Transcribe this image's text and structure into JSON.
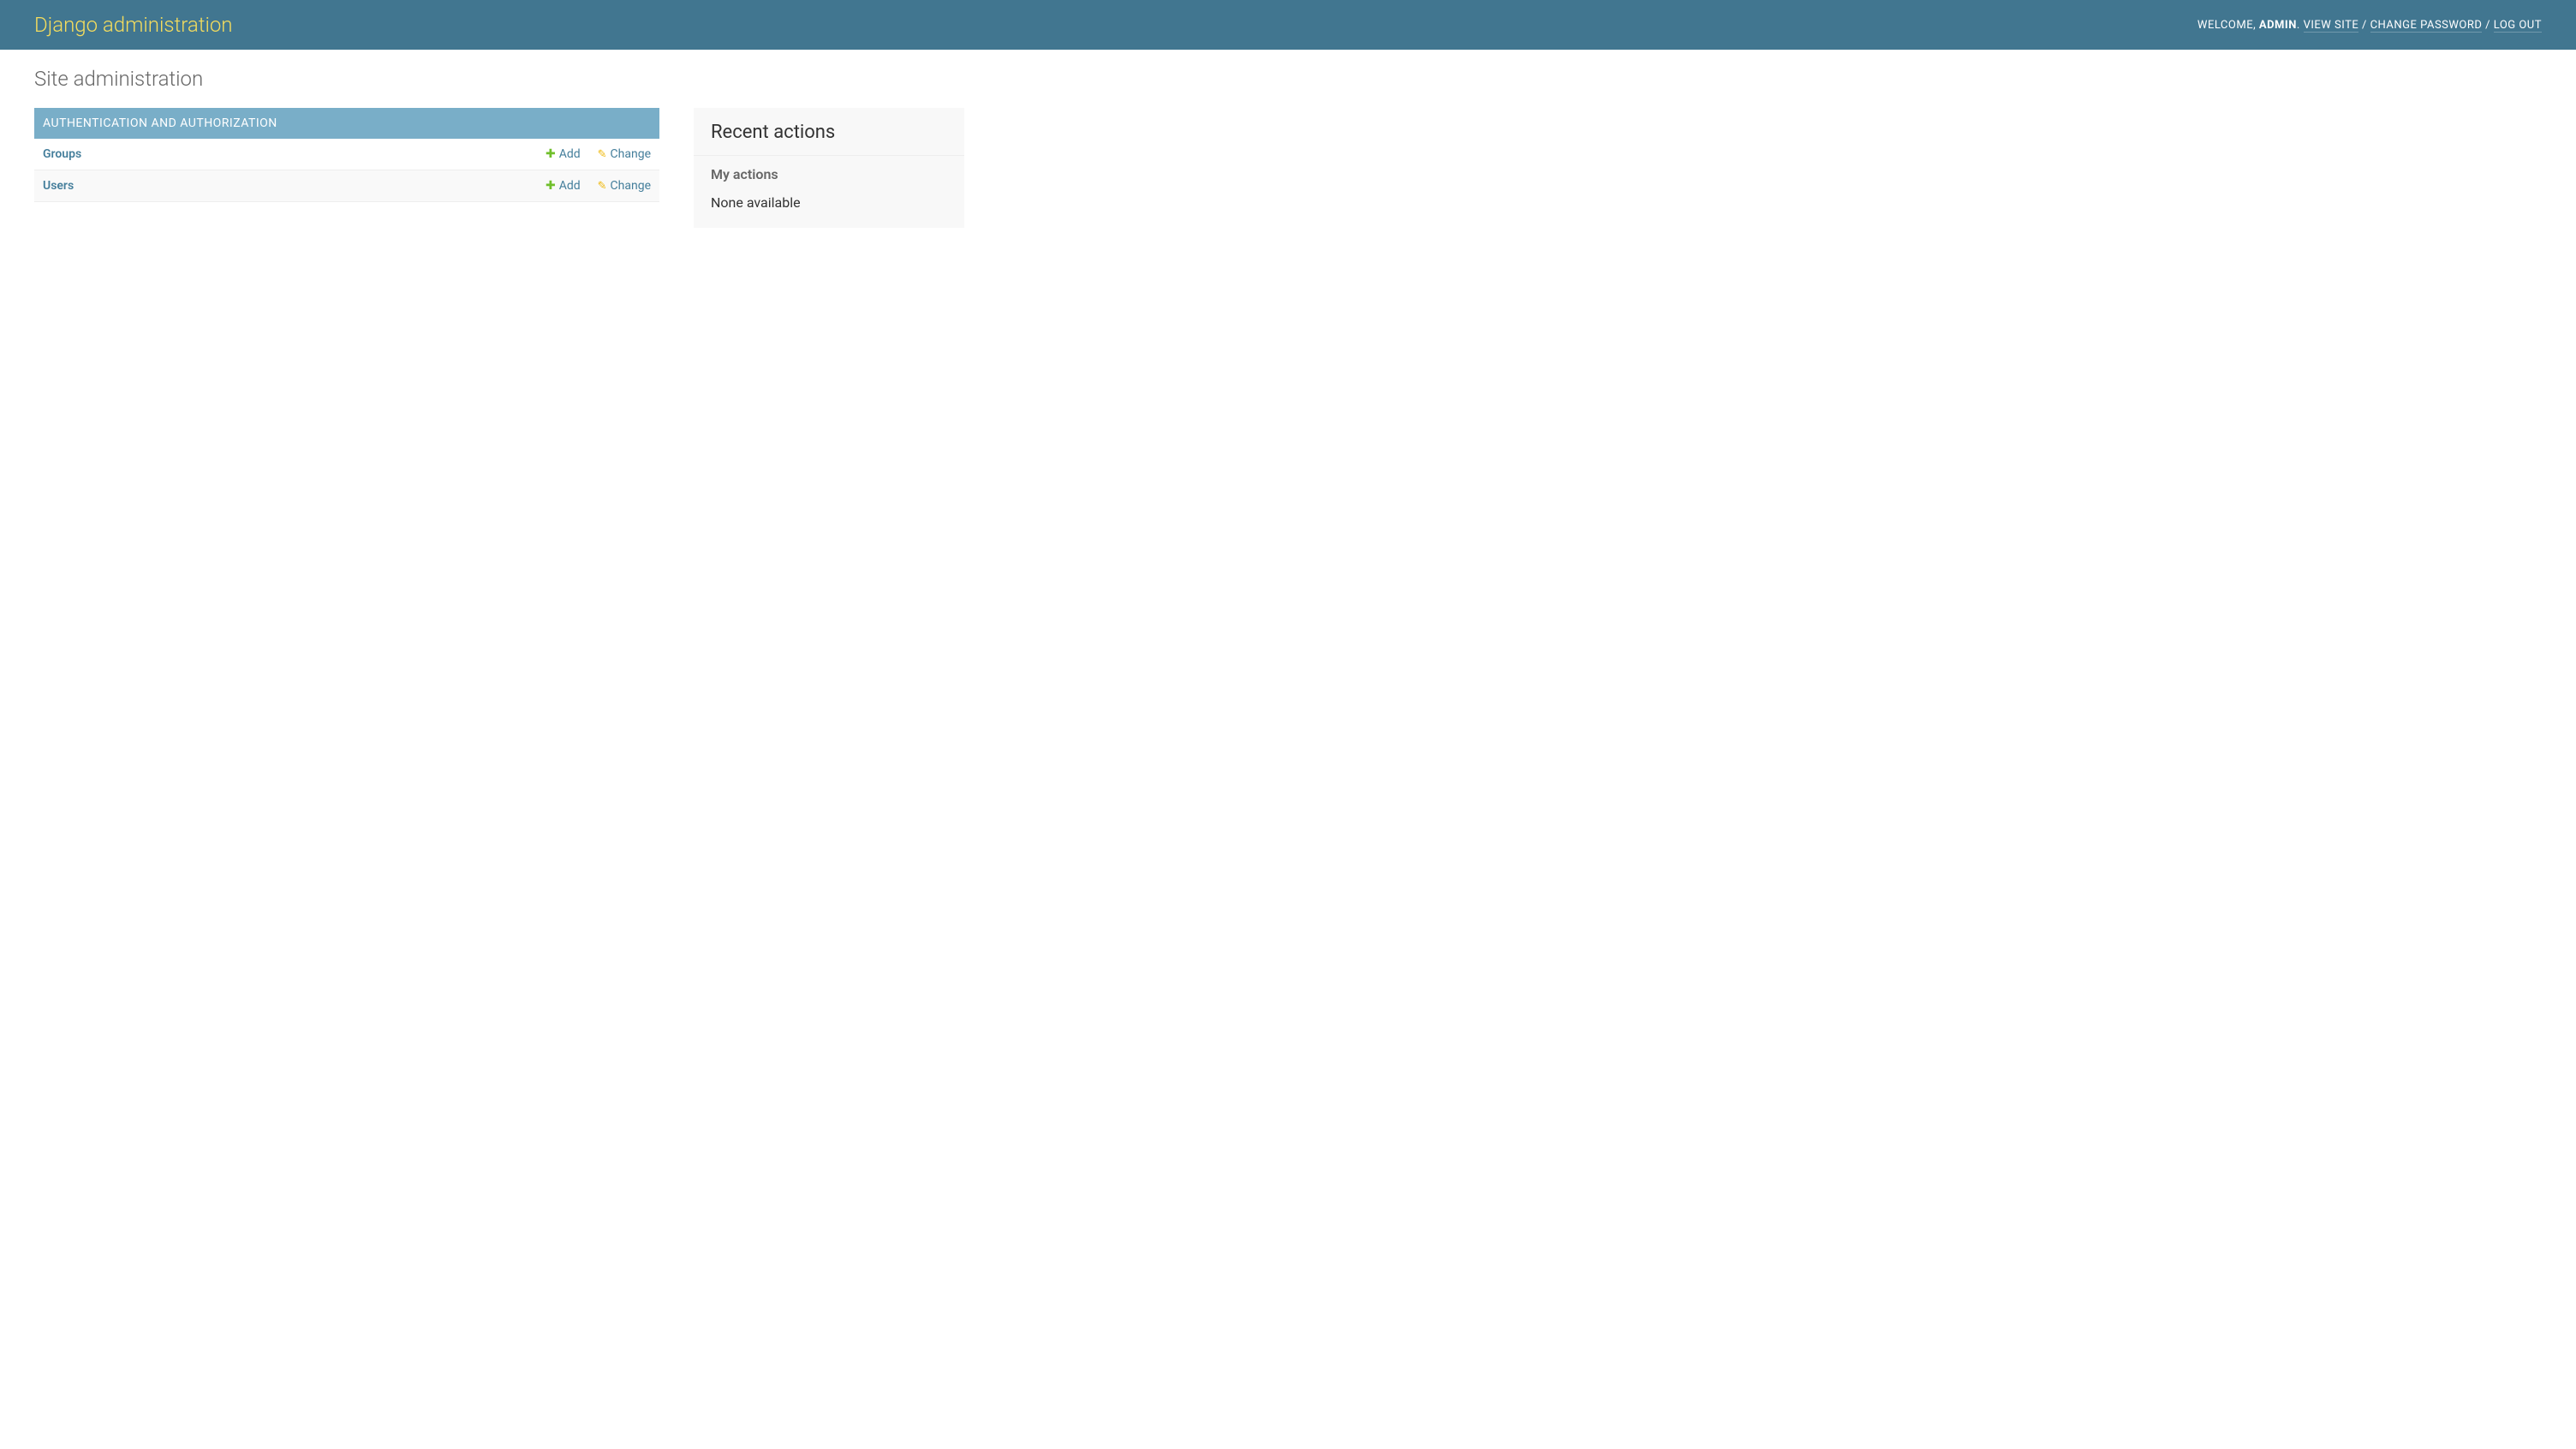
{
  "header": {
    "title": "Django administration",
    "welcome_prefix": "Welcome, ",
    "username": "admin",
    "separator_dot": ". ",
    "separator_slash": " / ",
    "view_site": "View site",
    "change_password": "Change password",
    "log_out": "Log out"
  },
  "content": {
    "page_title": "Site administration"
  },
  "apps": [
    {
      "caption": "Authentication and Authorization",
      "models": [
        {
          "name": "Groups",
          "add_label": "Add",
          "change_label": "Change"
        },
        {
          "name": "Users",
          "add_label": "Add",
          "change_label": "Change"
        }
      ]
    }
  ],
  "recent_actions": {
    "title": "Recent actions",
    "subtitle": "My actions",
    "empty_text": "None available"
  }
}
